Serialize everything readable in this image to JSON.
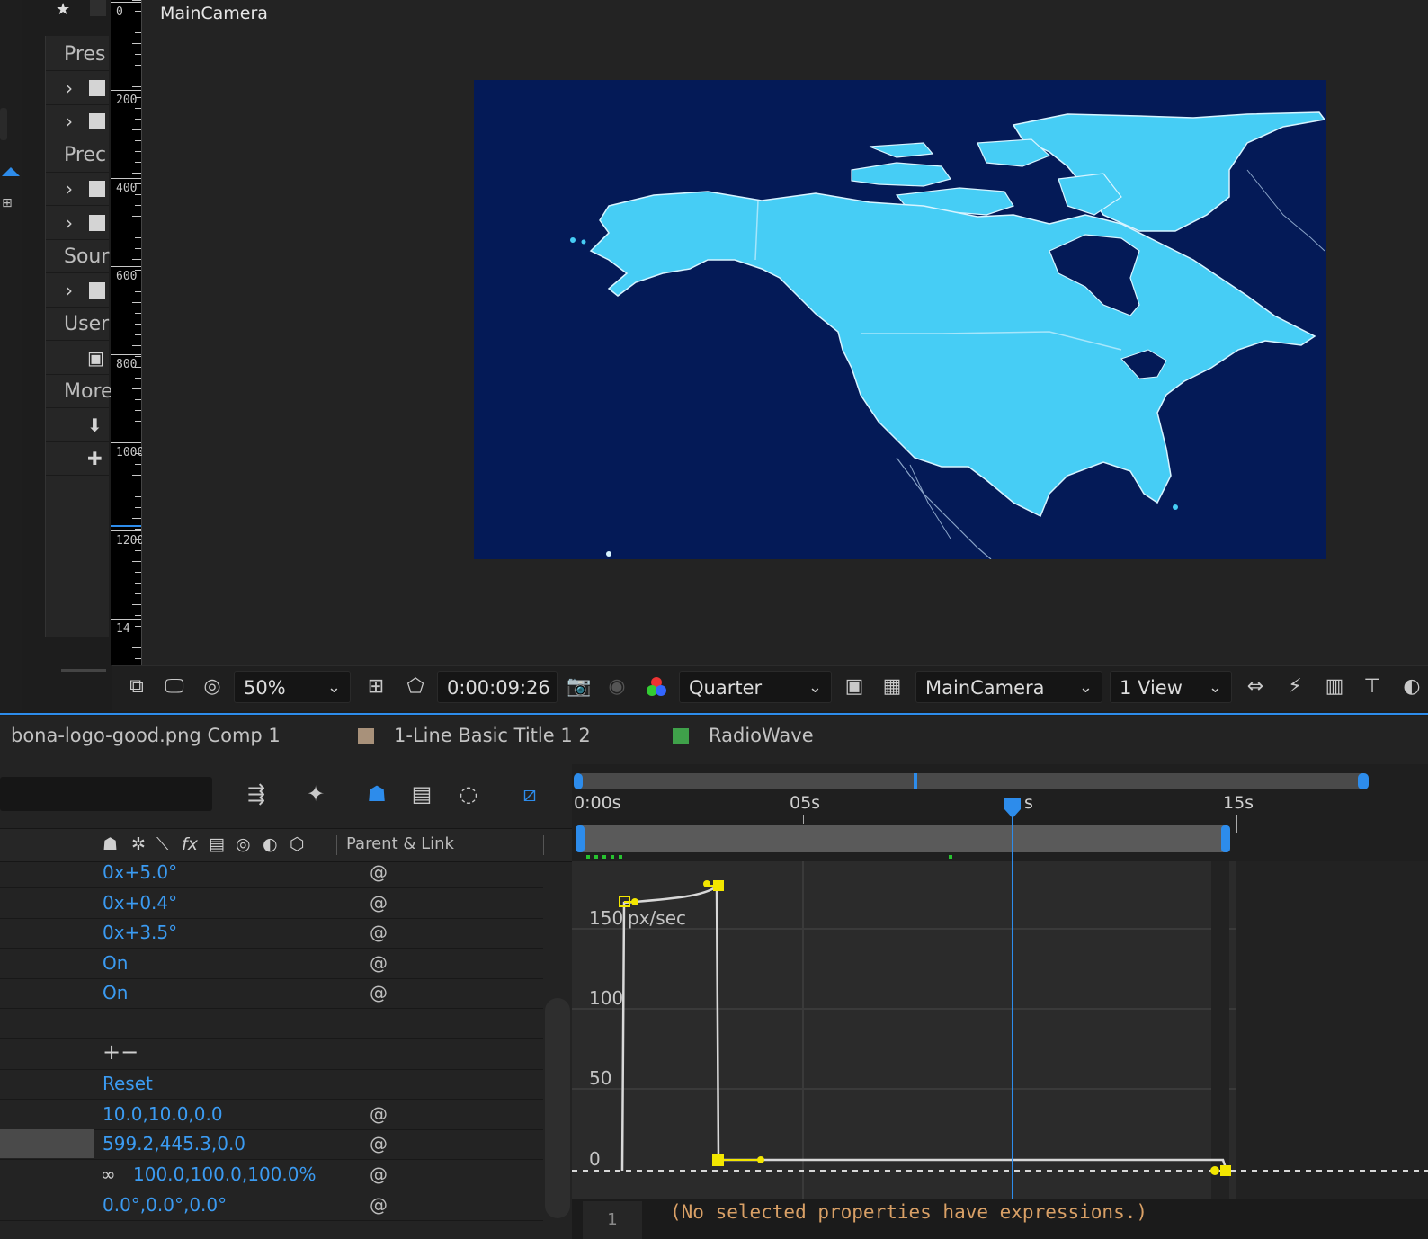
{
  "viewer": {
    "title": "MainCamera",
    "ruler_labels": [
      "0",
      "200",
      "400",
      "600",
      "800",
      "1000",
      "1200",
      "14"
    ]
  },
  "project_panel": {
    "rows": [
      {
        "type": "head",
        "label": "Pres"
      },
      {
        "type": "folder"
      },
      {
        "type": "folder"
      },
      {
        "type": "head",
        "label": "Prec"
      },
      {
        "type": "folder"
      },
      {
        "type": "folder"
      },
      {
        "type": "head",
        "label": "Sour"
      },
      {
        "type": "folder"
      },
      {
        "type": "head",
        "label": "User"
      },
      {
        "type": "icon",
        "icon": "new-folder-icon"
      },
      {
        "type": "head",
        "label": "More"
      },
      {
        "type": "icon",
        "icon": "download-icon"
      },
      {
        "type": "icon",
        "icon": "plus-icon"
      }
    ]
  },
  "viewer_toolbar": {
    "zoom": "50%",
    "timecode": "0:00:09:26",
    "resolution": "Quarter",
    "camera": "MainCamera",
    "views": "1 View"
  },
  "tabs": [
    {
      "label": "bona-logo-good.png Comp 1",
      "color": null
    },
    {
      "label": "1-Line Basic Title 1 2",
      "color": "#a8917a"
    },
    {
      "label": "RadioWave",
      "color": "#3fa14a"
    }
  ],
  "timeline": {
    "column_header": "Parent & Link",
    "properties": [
      {
        "value": "0x+5.0°",
        "has_expr": true
      },
      {
        "value": "0x+0.4°",
        "has_expr": true
      },
      {
        "value": "0x+3.5°",
        "has_expr": true
      },
      {
        "value": "On",
        "has_expr": true
      },
      {
        "value": "On",
        "has_expr": true
      },
      {
        "value": "",
        "has_expr": false
      },
      {
        "value": "+−",
        "has_expr": false
      },
      {
        "value": "Reset",
        "has_expr": false
      },
      {
        "value": "10.0,10.0,0.0",
        "has_expr": true
      },
      {
        "value": "599.2,445.3,0.0",
        "has_expr": true
      },
      {
        "value": "100.0,100.0,100.0%",
        "has_expr": true,
        "linked": true
      },
      {
        "value": "0.0°,0.0°,0.0°",
        "has_expr": true
      }
    ],
    "time_labels": [
      "0:00s",
      "05s",
      "s",
      "15s"
    ],
    "current_time_seconds": 9.87,
    "graph": {
      "unit": "px/sec",
      "y_labels": [
        "150",
        "100",
        "50",
        "0"
      ]
    },
    "expression": {
      "line_number": "1",
      "text": "(No selected properties have expressions.)"
    }
  },
  "colors": {
    "accent_blue": "#2d8ceb",
    "value_blue": "#3b9bf2",
    "keyframe_yellow": "#f2e600",
    "map_land": "#46cdf5",
    "map_ocean": "#041a57"
  }
}
